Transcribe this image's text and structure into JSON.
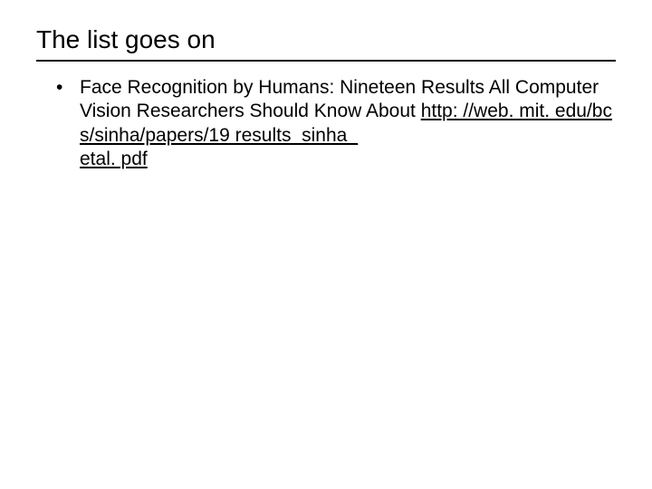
{
  "title": "The list goes on",
  "bullets": [
    {
      "text": "Face Recognition by Humans: Nineteen Results All Computer Vision Researchers Should Know About ",
      "link_line1": "http: //web. mit. edu/bcs/sinha/papers/19 results_sinha_",
      "link_line2": "etal. pdf"
    }
  ]
}
